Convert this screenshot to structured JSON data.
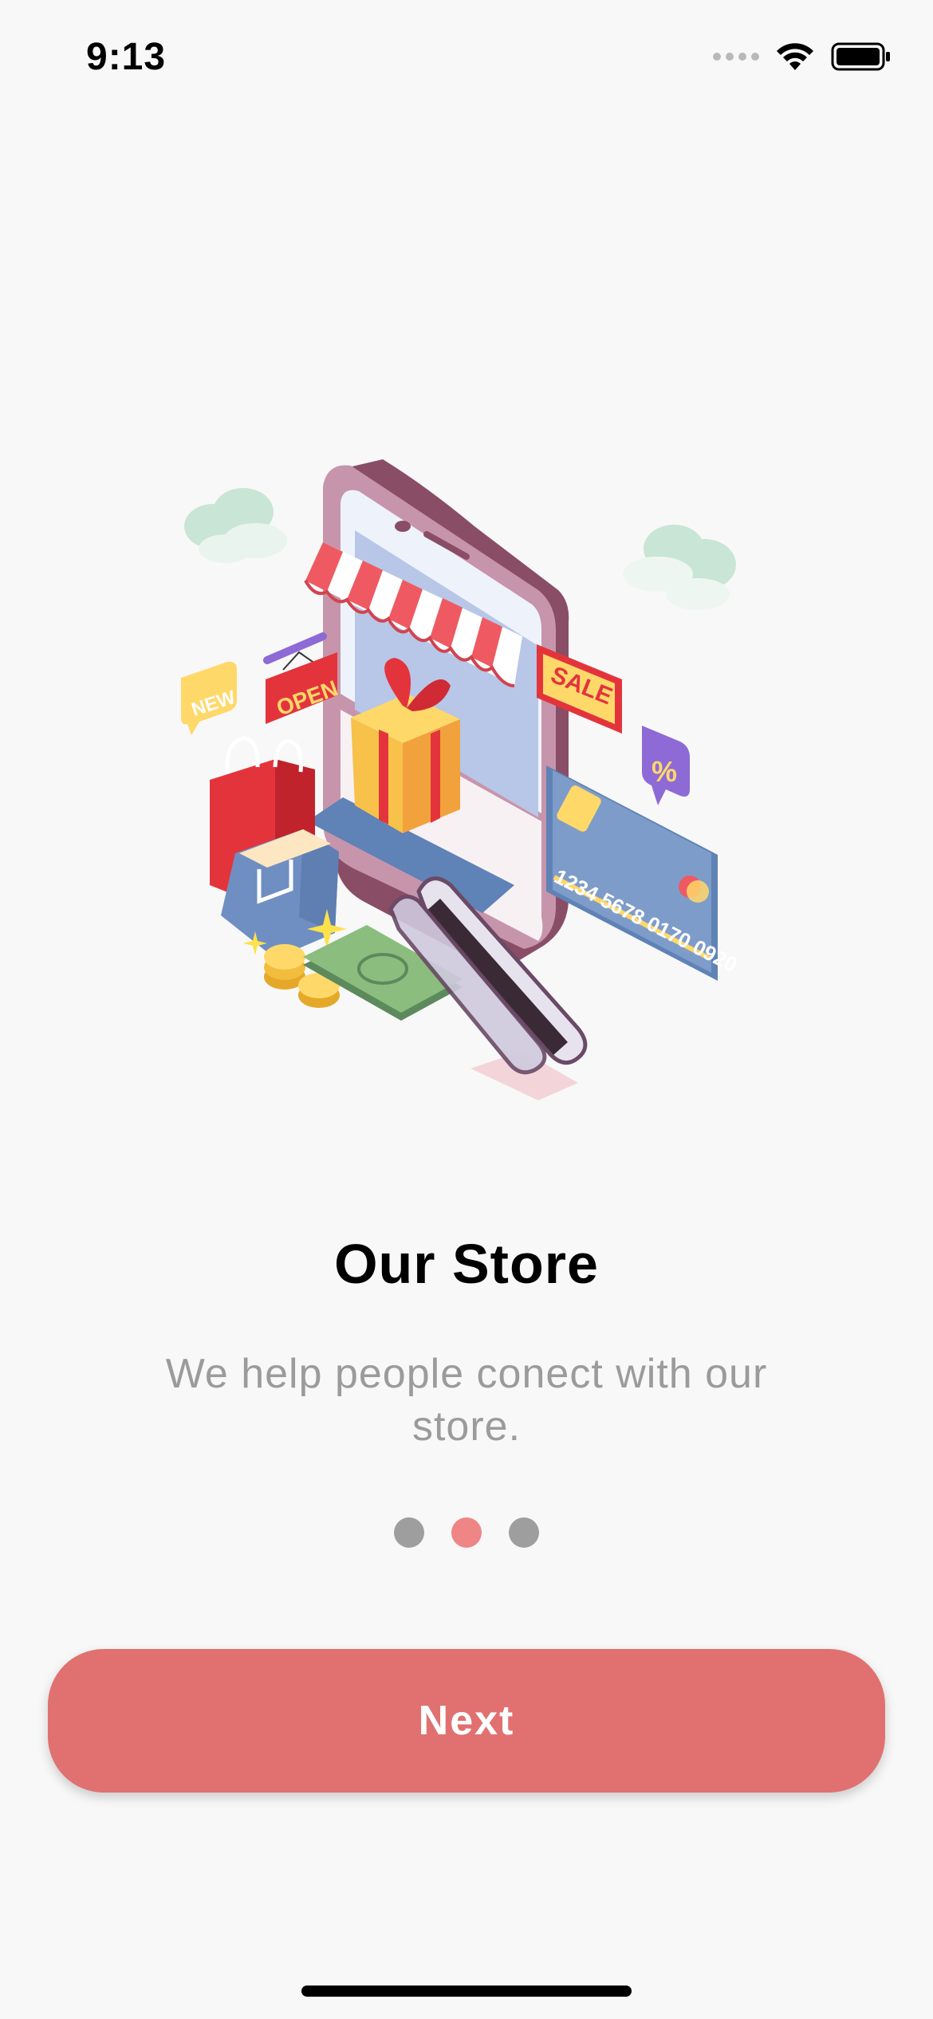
{
  "status_bar": {
    "time": "9:13",
    "icons": [
      "cellular-signal-icon",
      "wifi-icon",
      "battery-icon"
    ]
  },
  "illustration": {
    "icon": "shopping-store-illustration",
    "labels": {
      "new": "NEW",
      "open": "OPEN",
      "sale": "SALE",
      "percent": "%",
      "card_number": "1234 5678 0170 0920"
    }
  },
  "onboarding": {
    "title": "Our Store",
    "subtitle": "We help people conect with our store.",
    "page_count": 3,
    "active_page": 2
  },
  "actions": {
    "next_label": "Next"
  },
  "colors": {
    "accent": "#e07170",
    "dot_active": "#ef8585",
    "dot_inactive": "#9e9e9e",
    "subtitle": "#9b9b9b",
    "background": "#f8f8f8"
  }
}
